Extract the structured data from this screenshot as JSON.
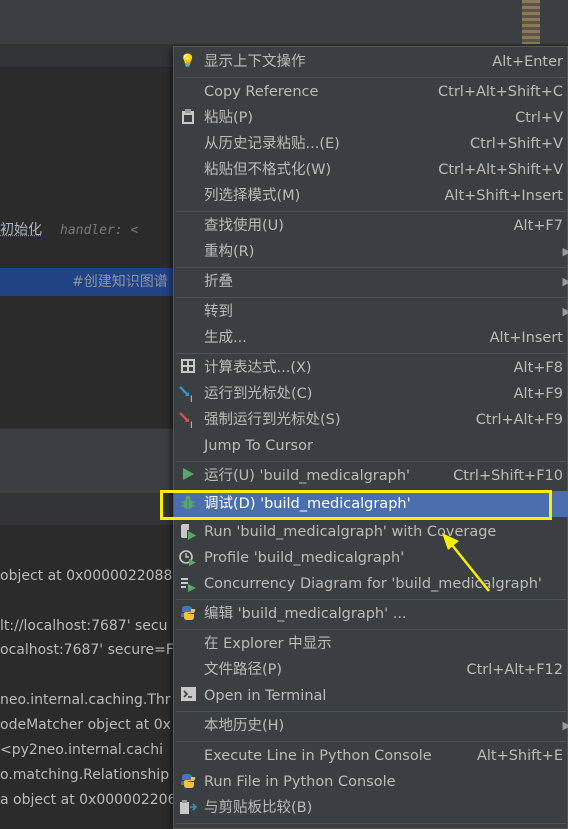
{
  "editor": {
    "code_fragment": "初始化",
    "param_hint": "handler: <",
    "comment": "#创建知识图谱"
  },
  "console": {
    "lines": [
      "object at 0x00000220886",
      "lt://localhost:7687' secu",
      "ocalhost:7687' secure=F",
      "neo.internal.caching.Thr",
      "odeMatcher object at 0x",
      "  <py2neo.internal.cachi",
      "o.matching.Relationship",
      "a object at 0x000002206"
    ]
  },
  "menu": {
    "items": [
      {
        "label": "显示上下文操作",
        "shortcut": "Alt+Enter",
        "icon": "lightbulb-icon"
      },
      {
        "label": "Copy Reference",
        "shortcut": "Ctrl+Alt+Shift+C"
      },
      {
        "label": "粘贴(P)",
        "shortcut": "Ctrl+V",
        "icon": "clipboard-icon"
      },
      {
        "label": "从历史记录粘贴...(E)",
        "shortcut": "Ctrl+Shift+V"
      },
      {
        "label": "粘贴但不格式化(W)",
        "shortcut": "Ctrl+Alt+Shift+V"
      },
      {
        "label": "列选择模式(M)",
        "shortcut": "Alt+Shift+Insert"
      },
      {
        "label": "查找使用(U)",
        "shortcut": "Alt+F7"
      },
      {
        "label": "重构(R)",
        "shortcut": ""
      },
      {
        "label": "折叠",
        "shortcut": ""
      },
      {
        "label": "转到",
        "shortcut": ""
      },
      {
        "label": "生成...",
        "shortcut": "Alt+Insert"
      },
      {
        "label": "计算表达式...(X)",
        "shortcut": "Alt+F8",
        "icon": "calculator-icon"
      },
      {
        "label": "运行到光标处(C)",
        "shortcut": "Alt+F9",
        "icon": "run-to-cursor-icon"
      },
      {
        "label": "强制运行到光标处(S)",
        "shortcut": "Ctrl+Alt+F9",
        "icon": "force-run-to-cursor-icon"
      },
      {
        "label": "Jump To Cursor",
        "shortcut": ""
      },
      {
        "label": "运行(U) 'build_medicalgraph'",
        "shortcut": "Ctrl+Shift+F10",
        "icon": "run-icon"
      },
      {
        "label": "调试(D) 'build_medicalgraph'",
        "shortcut": "",
        "icon": "debug-icon"
      },
      {
        "label": "Run 'build_medicalgraph' with Coverage",
        "shortcut": "",
        "icon": "coverage-icon"
      },
      {
        "label": "Profile 'build_medicalgraph'",
        "shortcut": "",
        "icon": "profile-icon"
      },
      {
        "label": "Concurrency Diagram for 'build_medicalgraph'",
        "shortcut": "",
        "icon": "concurrency-icon"
      },
      {
        "label": "编辑 'build_medicalgraph' ...",
        "shortcut": "",
        "icon": "python-icon"
      },
      {
        "label": "在 Explorer 中显示",
        "shortcut": ""
      },
      {
        "label": "文件路径(P)",
        "shortcut": "Ctrl+Alt+F12"
      },
      {
        "label": "Open in Terminal",
        "shortcut": "",
        "icon": "terminal-icon"
      },
      {
        "label": "本地历史(H)",
        "shortcut": ""
      },
      {
        "label": "Execute Line in Python Console",
        "shortcut": "Alt+Shift+E"
      },
      {
        "label": "Run File in Python Console",
        "shortcut": "",
        "icon": "python-icon"
      },
      {
        "label": "与剪贴板比较(B)",
        "shortcut": "",
        "icon": "compare-icon"
      }
    ]
  },
  "colors": {
    "highlight": "#4b6eaf",
    "annotation": "#f5f000"
  }
}
